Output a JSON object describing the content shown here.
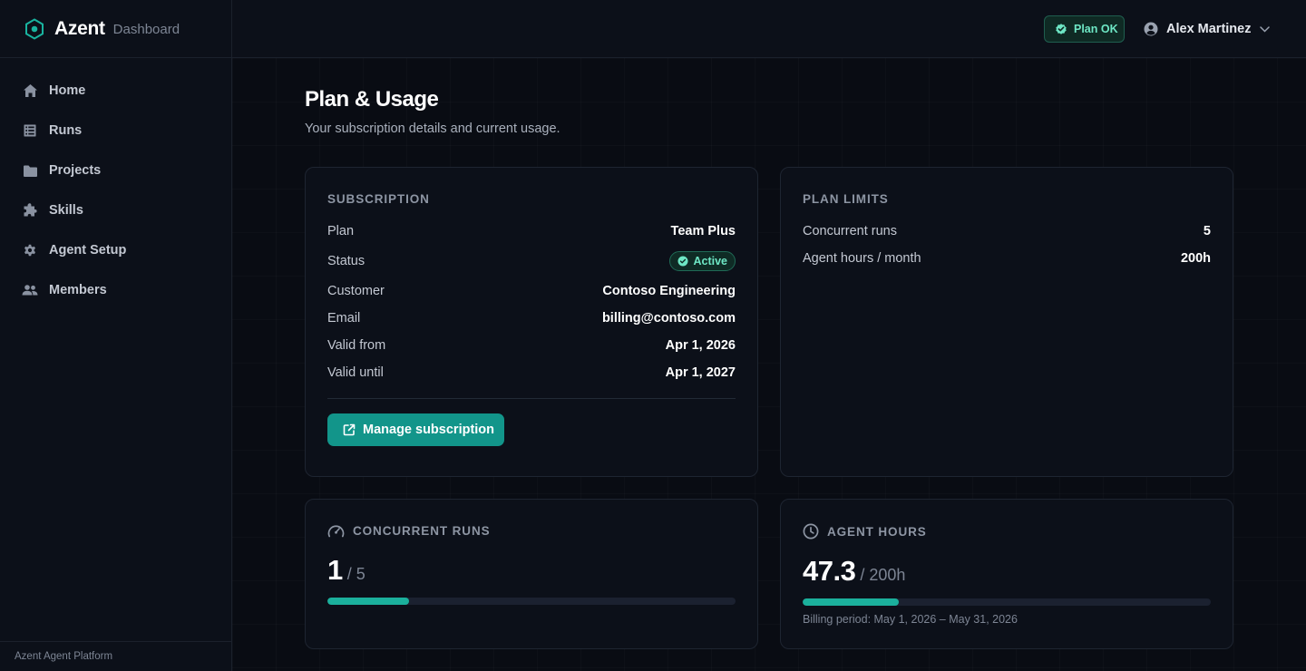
{
  "brand": {
    "name": "Azent",
    "section": "Dashboard",
    "footer": "Azent Agent Platform"
  },
  "nav": [
    {
      "label": "Home",
      "icon": "home-icon"
    },
    {
      "label": "Runs",
      "icon": "list-icon"
    },
    {
      "label": "Projects",
      "icon": "folder-icon"
    },
    {
      "label": "Skills",
      "icon": "puzzle-icon"
    },
    {
      "label": "Agent Setup",
      "icon": "gear-icon"
    },
    {
      "label": "Members",
      "icon": "people-icon"
    }
  ],
  "topbar": {
    "plan_status": "Plan OK",
    "user_name": "Alex Martinez"
  },
  "page": {
    "title": "Plan & Usage",
    "subtitle": "Your subscription details and current usage."
  },
  "subscription": {
    "title": "SUBSCRIPTION",
    "rows": [
      {
        "label": "Plan",
        "value": "Team Plus"
      },
      {
        "label": "Status",
        "value": "Active"
      },
      {
        "label": "Customer",
        "value": "Contoso Engineering"
      },
      {
        "label": "Email",
        "value": "billing@contoso.com"
      },
      {
        "label": "Valid from",
        "value": "Apr 1, 2026"
      },
      {
        "label": "Valid until",
        "value": "Apr 1, 2027"
      }
    ],
    "manage_label": "Manage subscription"
  },
  "limits": {
    "title": "PLAN LIMITS",
    "rows": [
      {
        "label": "Concurrent runs",
        "value": "5"
      },
      {
        "label": "Agent hours / month",
        "value": "200h"
      }
    ]
  },
  "usage": {
    "runs": {
      "title": "CONCURRENT RUNS",
      "value": "1",
      "of": "/ 5",
      "fraction": 0.2
    },
    "hours": {
      "title": "AGENT HOURS",
      "value": "47.3",
      "of": "/ 200h",
      "fraction": 0.2365,
      "period": "Billing period: May 1, 2026 – May 31, 2026"
    }
  },
  "colors": {
    "accent": "#12958a",
    "success": "#6ee7c5",
    "bar_fill": "#1bb09c"
  }
}
